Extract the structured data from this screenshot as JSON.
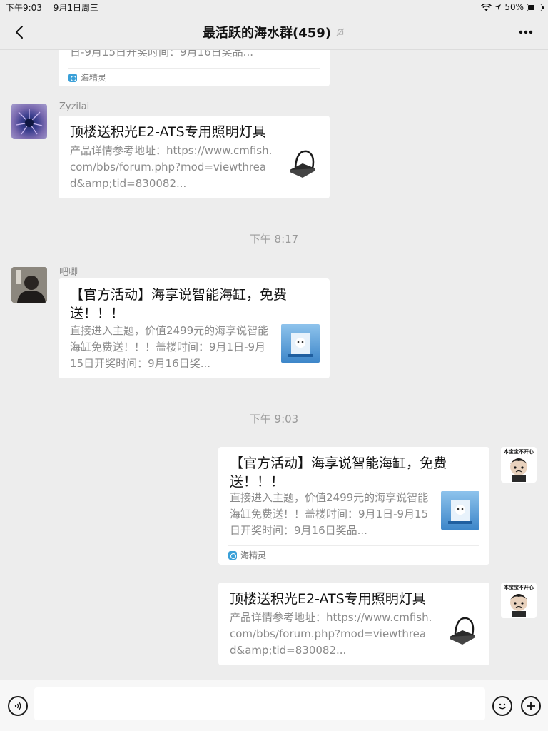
{
  "status_bar": {
    "time": "下午9:03",
    "date": "9月1日周三",
    "battery": "50%",
    "battery_level": 0.5
  },
  "nav": {
    "title": "最活跃的海水群(459)"
  },
  "messages": [
    {
      "desc_partial": "日-9月15日开奖时间：9月16日奖品...",
      "source": "海精灵"
    },
    {
      "sender": "Zyzilai",
      "title": "顶楼送积光E2-ATS专用照明灯具",
      "desc": "产品详情参考地址：https://www.cmfish.com/bbs/forum.php?mod=viewthread&amp;tid=830082..."
    },
    {
      "timestamp": "下午 8:17"
    },
    {
      "sender": "吧唧",
      "title": "【官方活动】海享说智能海缸，免费送！！！",
      "desc": "直接进入主题，价值2499元的海享说智能海缸免费送！！！盖楼时间：9月1日-9月15日开奖时间：9月16日奖..."
    },
    {
      "timestamp": "下午 9:03"
    },
    {
      "title": "【官方活动】海享说智能海缸，免费送！！！",
      "desc": "直接进入主题，价值2499元的海享说智能海缸免费送！！盖楼时间：9月1日-9月15日开奖时间：9月16日奖品...",
      "source": "海精灵"
    },
    {
      "title": "顶楼送积光E2-ATS专用照明灯具",
      "desc": "产品详情参考地址：https://www.cmfish.com/bbs/forum.php?mod=viewthread&amp;tid=830082..."
    }
  ],
  "self_avatar_caption": "本宝宝不开心",
  "icons": {
    "back": "back-chevron-icon",
    "mute": "mute-bell-icon",
    "more": "more-dots-icon",
    "voice": "voice-icon",
    "emoji": "emoji-icon",
    "plus": "plus-icon"
  }
}
